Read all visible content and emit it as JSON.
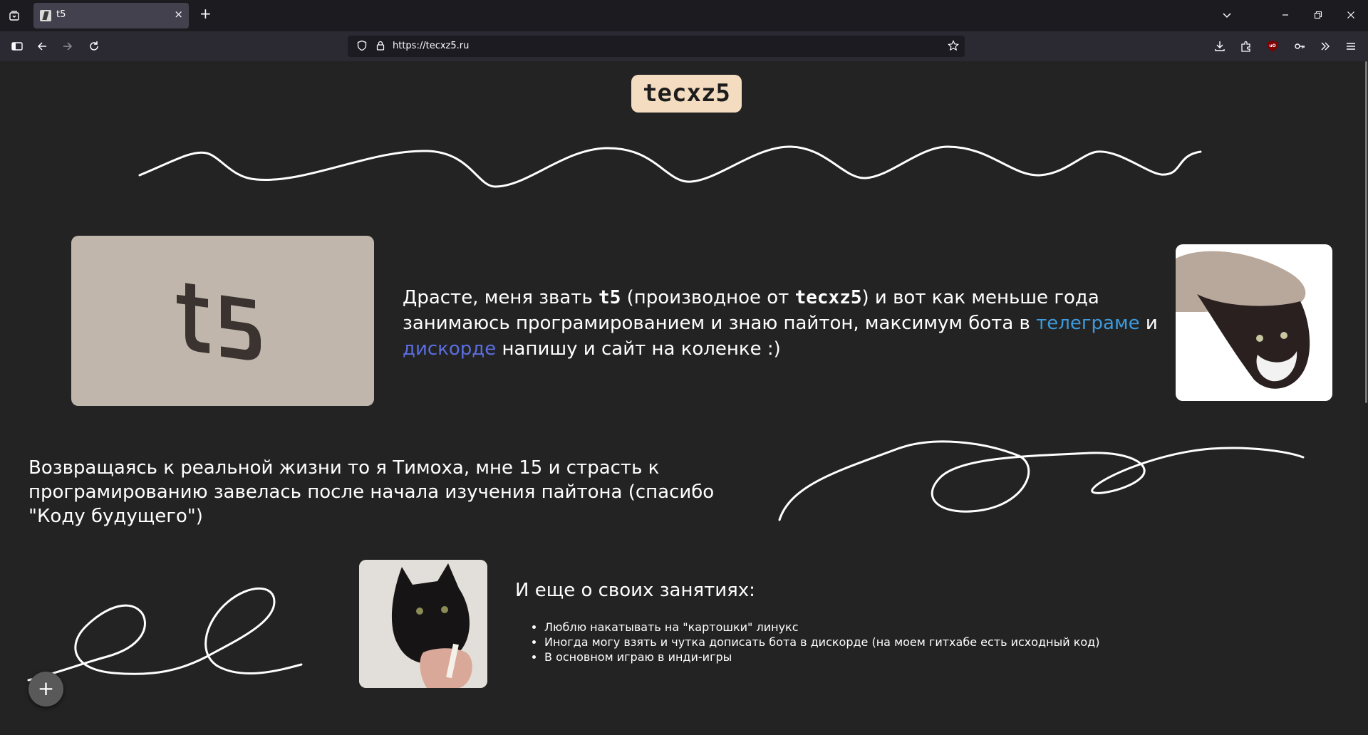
{
  "browser": {
    "tab_title": "t5",
    "url": "https://tecxz5.ru",
    "new_tab_label": "+",
    "close_tab_label": "×"
  },
  "page": {
    "logo": "tecxz5",
    "card_logo": "t5",
    "intro": {
      "part1": "Драсте, меня звать ",
      "name_short": "t5",
      "part2": " (производное от ",
      "name_full": "tecxz5",
      "part3": ") и вот как меньше года занимаюсь програмированием и знаю пайтон, максимум бота в ",
      "link_telegram": "телеграме",
      "and": " и ",
      "link_discord": "дискорде",
      "part4": " напишу и сайт на коленке :)"
    },
    "about": "Возвращаясь к реальной жизни то я Тимоха, мне 15 и страсть к програмированию завелась после начала изучения пайтона (спасибо \"Коду будущего\")",
    "hobbies_title": "И еще о своих занятиях:",
    "hobbies": [
      "Люблю накатывать на \"картошки\" линукс",
      "Иногда могу взять и чутка дописать бота в дискорде (на моем гитхабе есть исходный код)",
      "В основном играю в инди-игры"
    ],
    "fab_label": "+"
  },
  "colors": {
    "background": "#232323",
    "logo_bg": "#f3dcbf",
    "card_bg": "#c0b6ab",
    "telegram_link": "#3c9ade",
    "discord_link": "#5b6ee0"
  }
}
